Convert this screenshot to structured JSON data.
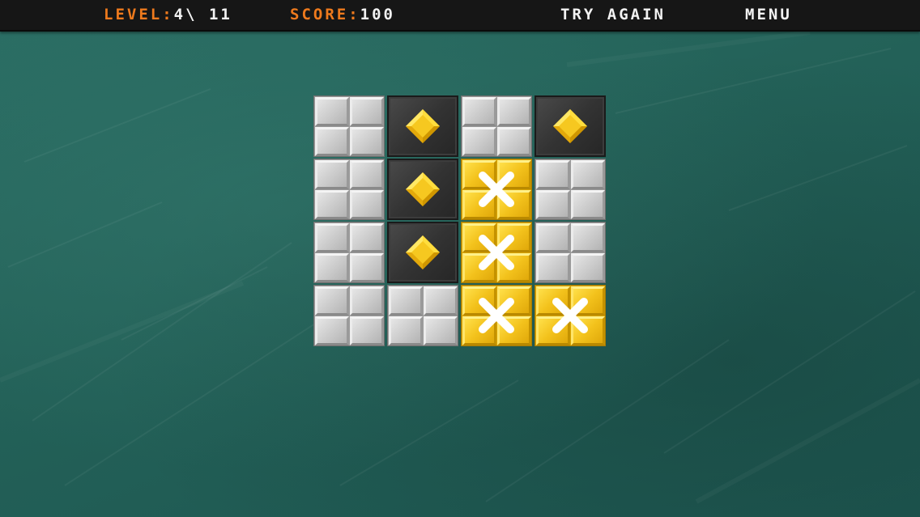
{
  "hud": {
    "level_label": "LEVEL:",
    "level_value": "4\\ 11",
    "score_label": "SCORE:",
    "score_value": "100"
  },
  "buttons": {
    "try_again": "TRY AGAIN",
    "menu": "MENU"
  },
  "colors": {
    "board_background": "#236158",
    "topbar": "#161616",
    "hud_label": "#ee7a1d",
    "hud_value": "#f2f2f2",
    "gray_block": "#cfcfcf",
    "dark_block": "#333333",
    "gem": "#f3c21c",
    "yellow_block": "#f3c21c",
    "x_mark": "#ffffff"
  },
  "grid": {
    "rows": 4,
    "cols": 4,
    "cells": [
      [
        "gray",
        "dark-gem",
        "gray",
        "dark-gem"
      ],
      [
        "gray",
        "dark-gem",
        "yellow-x",
        "gray"
      ],
      [
        "gray",
        "dark-gem",
        "yellow-x",
        "gray"
      ],
      [
        "gray",
        "gray",
        "yellow-x",
        "yellow-x"
      ]
    ]
  },
  "icons": {
    "gem": "gem-diamond-icon",
    "x": "x-mark-icon"
  }
}
